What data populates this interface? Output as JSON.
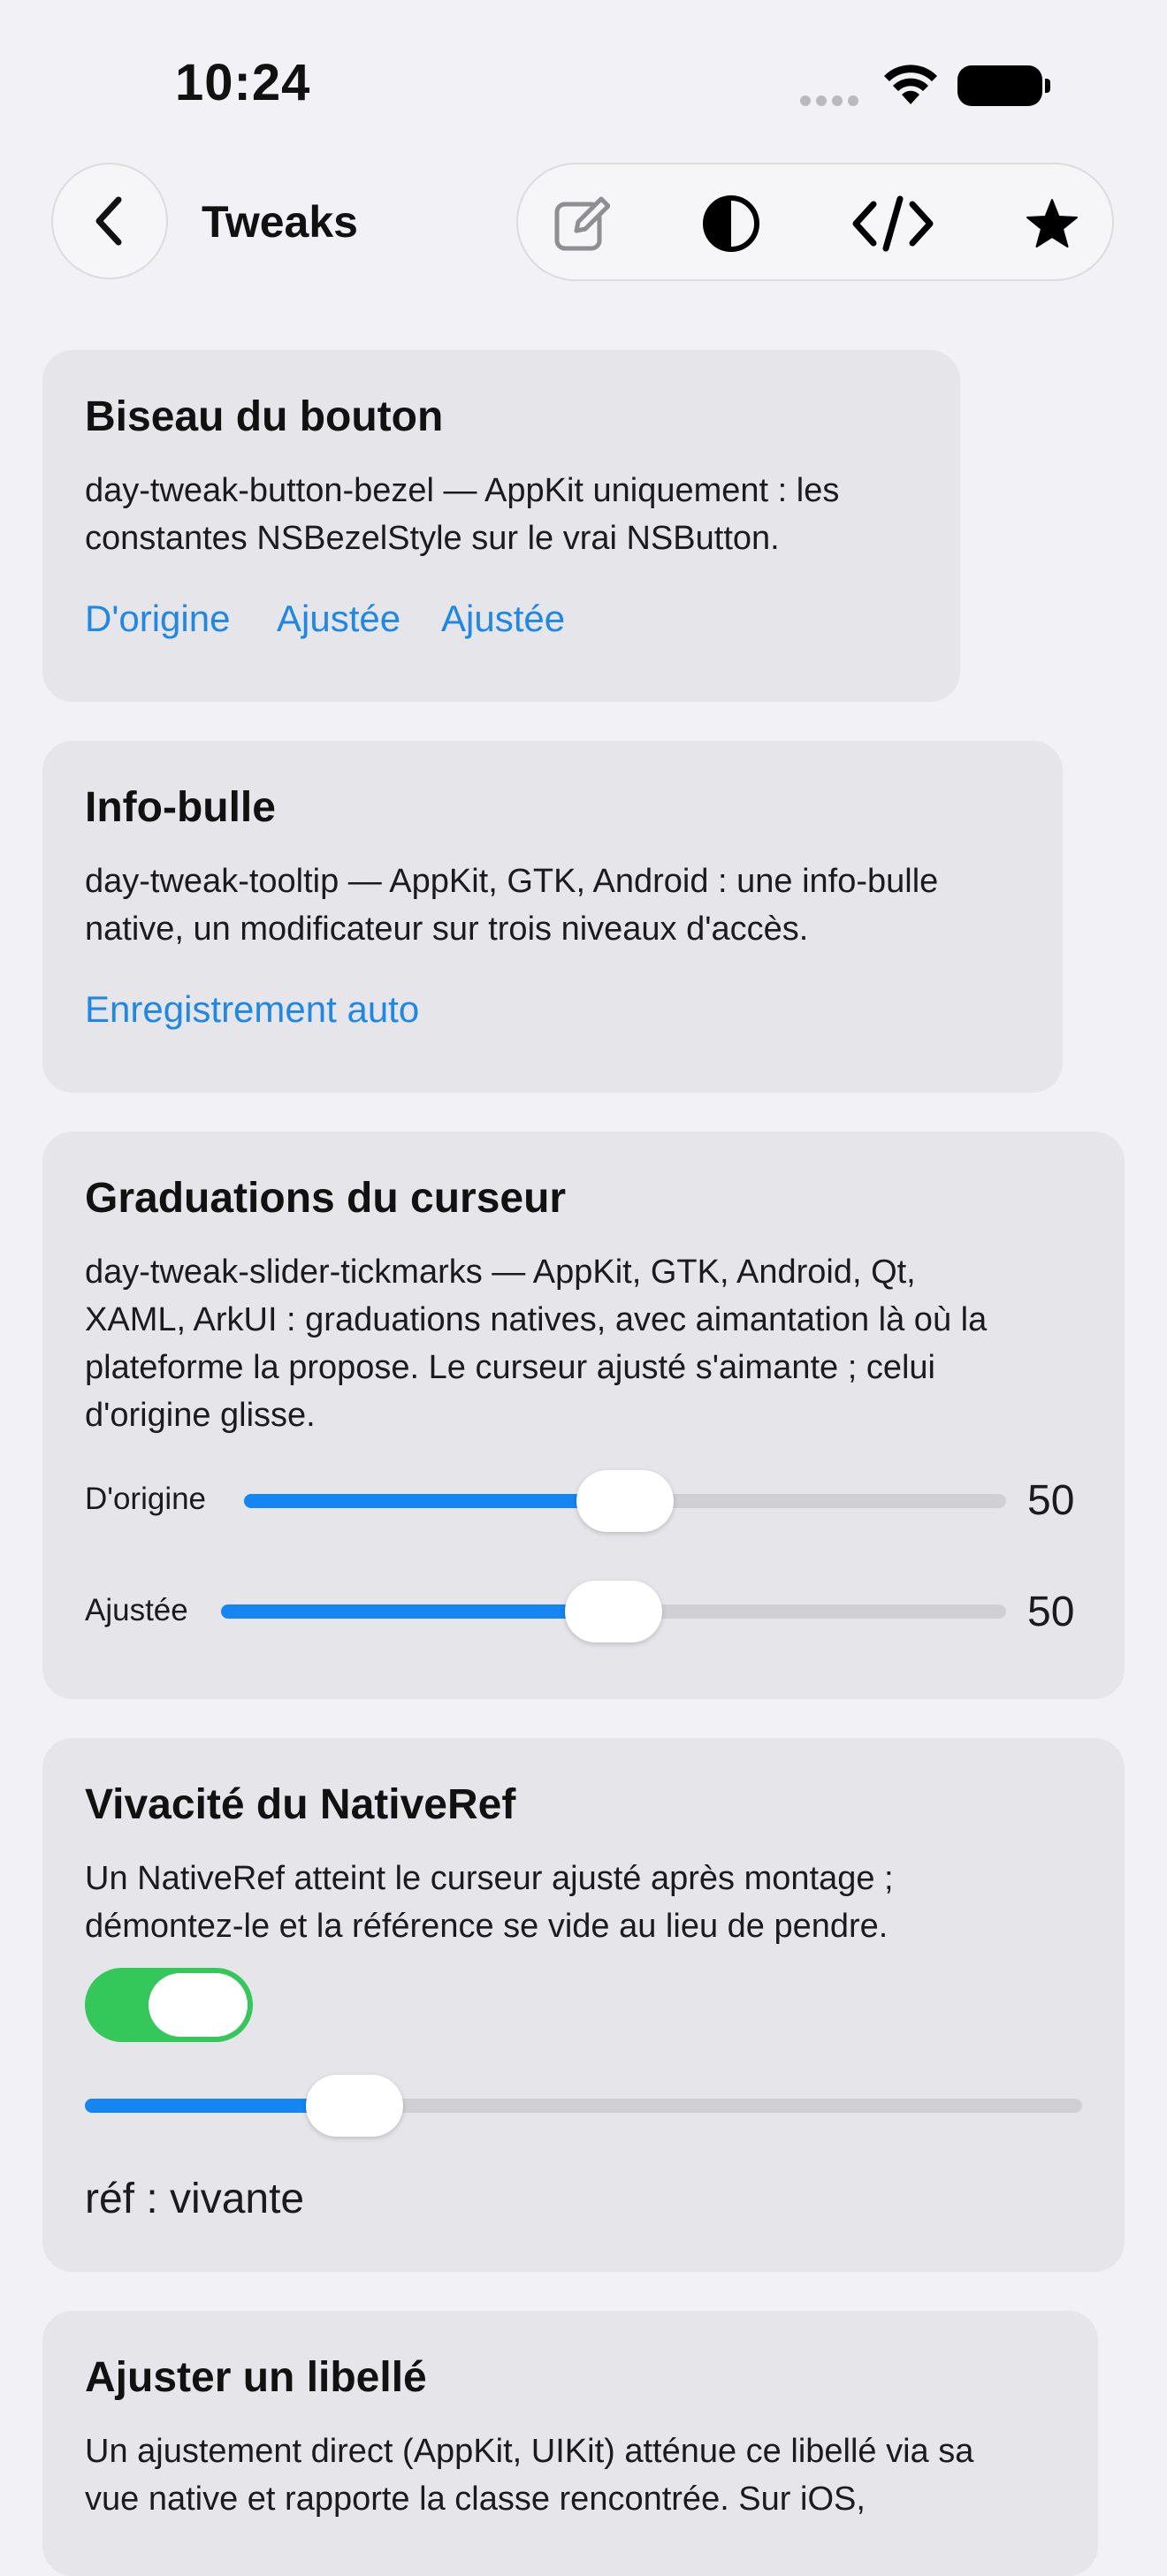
{
  "status_bar": {
    "time": "10:24"
  },
  "nav": {
    "title": "Tweaks",
    "back_icon": "chevron-left-icon",
    "toolbar_icons": [
      "compose-icon",
      "contrast-icon",
      "code-icon",
      "star-icon"
    ]
  },
  "colors": {
    "background": "#f2f2f6",
    "card": "#e5e5ea",
    "link": "#1e88e5",
    "slider_fill": "#1585f2",
    "toggle_on": "#34c759"
  },
  "cards": [
    {
      "title": "Biseau du bouton",
      "description": "day-tweak-button-bezel — AppKit uniquement : les\nconstantes NSBezelStyle sur le vrai NSButton.",
      "links": [
        "D'origine",
        "Ajustée",
        "Ajustée"
      ]
    },
    {
      "title": "Info-bulle",
      "description": "day-tweak-tooltip — AppKit, GTK, Android : une info-bulle\nnative, un modificateur sur trois niveaux d'accès.",
      "links": [
        "Enregistrement auto"
      ]
    },
    {
      "title": "Graduations du curseur",
      "description": "day-tweak-slider-tickmarks — AppKit, GTK, Android, Qt,\nXAML, ArkUI : graduations natives, avec aimantation là où la\nplateforme la propose. Le curseur ajusté s'aimante ; celui\nd'origine glisse.",
      "sliders": [
        {
          "label": "D'origine",
          "value": "50",
          "fraction": 0.5
        },
        {
          "label": "Ajustée",
          "value": "50",
          "fraction": 0.5
        }
      ]
    },
    {
      "title": "Vivacité du NativeRef",
      "description": "Un NativeRef atteint le curseur ajusté après montage ;\ndémontez-le et la référence se vide au lieu de pendre.",
      "toggle_on": true,
      "slider_fraction": 0.27,
      "status": "réf : vivante"
    },
    {
      "title": "Ajuster un libellé",
      "description": "Un ajustement direct (AppKit, UIKit) atténue ce libellé via sa\nvue native et rapporte la classe rencontrée. Sur iOS,"
    }
  ]
}
